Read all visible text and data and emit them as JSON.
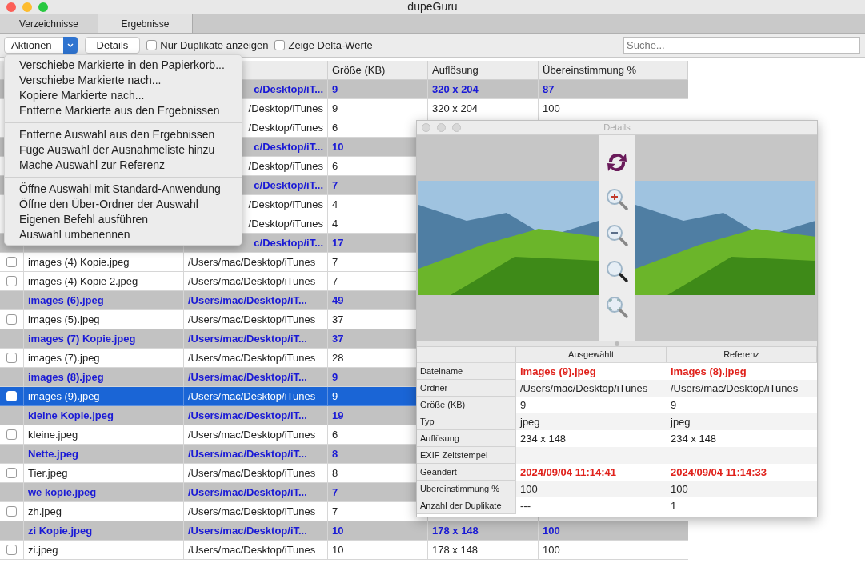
{
  "window": {
    "title": "dupeGuru"
  },
  "tabs": [
    {
      "label": "Verzeichnisse",
      "selected": false
    },
    {
      "label": "Ergebnisse",
      "selected": true
    }
  ],
  "toolbar": {
    "actions_label": "Aktionen",
    "details_label": "Details",
    "options": [
      {
        "label": "Nur Duplikate anzeigen",
        "checked": false
      },
      {
        "label": "Zeige Delta-Werte",
        "checked": false
      }
    ],
    "search": {
      "placeholder": "Suche..."
    }
  },
  "table": {
    "columns": [
      "Größe (KB)",
      "Auflösung",
      "Übereinstimmung %"
    ],
    "rows": [
      {
        "reference": true,
        "selected": false,
        "folder": "c/Desktop/iT...",
        "size": "9",
        "resolution": "320 x 204",
        "match": "87"
      },
      {
        "reference": false,
        "selected": false,
        "folder": "/Desktop/iTunes",
        "size": "9",
        "resolution": "320 x 204",
        "match": "100"
      },
      {
        "reference": false,
        "selected": false,
        "folder": "/Desktop/iTunes",
        "size": "6"
      },
      {
        "reference": true,
        "selected": false,
        "folder": "c/Desktop/iT...",
        "size": "10"
      },
      {
        "reference": false,
        "selected": false,
        "folder": "/Desktop/iTunes",
        "size": "6"
      },
      {
        "reference": true,
        "selected": false,
        "folder": "c/Desktop/iT...",
        "size": "7"
      },
      {
        "reference": false,
        "selected": false,
        "folder": "/Desktop/iTunes",
        "size": "4"
      },
      {
        "reference": false,
        "selected": false,
        "folder": "/Desktop/iTunes",
        "size": "4"
      },
      {
        "reference": true,
        "selected": false,
        "folder": "c/Desktop/iT...",
        "size": "17"
      },
      {
        "reference": false,
        "selected": false,
        "checked": false,
        "name": "images (4) Kopie.jpeg",
        "folder": "/Users/mac/Desktop/iTunes",
        "size": "7"
      },
      {
        "reference": false,
        "selected": false,
        "checked": false,
        "name": "images (4) Kopie 2.jpeg",
        "folder": "/Users/mac/Desktop/iTunes",
        "size": "7"
      },
      {
        "reference": true,
        "selected": false,
        "name": "images (6).jpeg",
        "folder": "/Users/mac/Desktop/iT...",
        "size": "49"
      },
      {
        "reference": false,
        "selected": false,
        "checked": false,
        "name": "images (5).jpeg",
        "folder": "/Users/mac/Desktop/iTunes",
        "size": "37"
      },
      {
        "reference": true,
        "selected": false,
        "name": "images (7) Kopie.jpeg",
        "folder": "/Users/mac/Desktop/iT...",
        "size": "37"
      },
      {
        "reference": false,
        "selected": false,
        "checked": false,
        "name": "images (7).jpeg",
        "folder": "/Users/mac/Desktop/iTunes",
        "size": "28"
      },
      {
        "reference": true,
        "selected": false,
        "name": "images (8).jpeg",
        "folder": "/Users/mac/Desktop/iT...",
        "size": "9"
      },
      {
        "reference": false,
        "selected": true,
        "checked": false,
        "name": "images (9).jpeg",
        "folder": "/Users/mac/Desktop/iTunes",
        "size": "9"
      },
      {
        "reference": true,
        "selected": false,
        "name": "kleine Kopie.jpeg",
        "folder": "/Users/mac/Desktop/iT...",
        "size": "19"
      },
      {
        "reference": false,
        "selected": false,
        "checked": false,
        "name": "kleine.jpeg",
        "folder": "/Users/mac/Desktop/iTunes",
        "size": "6"
      },
      {
        "reference": true,
        "selected": false,
        "name": "Nette.jpeg",
        "folder": "/Users/mac/Desktop/iT...",
        "size": "8"
      },
      {
        "reference": false,
        "selected": false,
        "checked": false,
        "name": "Tier.jpeg",
        "folder": "/Users/mac/Desktop/iTunes",
        "size": "8"
      },
      {
        "reference": true,
        "selected": false,
        "name": "we kopie.jpeg",
        "folder": "/Users/mac/Desktop/iT...",
        "size": "7"
      },
      {
        "reference": false,
        "selected": false,
        "checked": false,
        "name": "zh.jpeg",
        "folder": "/Users/mac/Desktop/iTunes",
        "size": "7"
      },
      {
        "reference": true,
        "selected": false,
        "name": "zi Kopie.jpeg",
        "folder": "/Users/mac/Desktop/iT...",
        "size": "10",
        "resolution": "178 x 148",
        "match": "100"
      },
      {
        "reference": false,
        "selected": false,
        "checked": false,
        "name": "zi.jpeg",
        "folder": "/Users/mac/Desktop/iTunes",
        "size": "10",
        "resolution": "178 x 148",
        "match": "100"
      }
    ]
  },
  "actions_menu": {
    "groups": [
      [
        "Verschiebe Markierte in den Papierkorb...",
        "Verschiebe Markierte nach...",
        "Kopiere Markierte nach...",
        "Entferne Markierte aus den Ergebnissen"
      ],
      [
        "Entferne Auswahl aus den Ergebnissen",
        "Füge Auswahl der Ausnahmeliste hinzu",
        "Mache Auswahl zur Referenz"
      ],
      [
        "Öffne Auswahl mit Standard-Anwendung",
        "Öffne den Über-Ordner der Auswahl",
        "Eigenen Befehl ausführen",
        "Auswahl umbenennen"
      ]
    ]
  },
  "details_window": {
    "title": "Details",
    "columns": [
      "Ausgewählt",
      "Referenz"
    ],
    "rows": [
      {
        "label": "Dateiname",
        "selected": "images (9).jpeg",
        "reference": "images (8).jpeg",
        "differs": true
      },
      {
        "label": "Ordner",
        "selected": "/Users/mac/Desktop/iTunes",
        "reference": "/Users/mac/Desktop/iTunes",
        "differs": false
      },
      {
        "label": "Größe (KB)",
        "selected": "9",
        "reference": "9",
        "differs": false
      },
      {
        "label": "Typ",
        "selected": "jpeg",
        "reference": "jpeg",
        "differs": false
      },
      {
        "label": "Auflösung",
        "selected": "234 x 148",
        "reference": "234 x 148",
        "differs": false
      },
      {
        "label": "EXIF Zeitstempel"
      },
      {
        "label": "Geändert",
        "selected": "2024/09/04 11:14:41",
        "reference": "2024/09/04 11:14:33",
        "differs": true
      },
      {
        "label": "Übereinstimmung %",
        "selected": "100",
        "reference": "100",
        "differs": false
      },
      {
        "label": "Anzahl der Duplikate",
        "selected": "---",
        "reference": "1",
        "differs": false
      }
    ]
  }
}
